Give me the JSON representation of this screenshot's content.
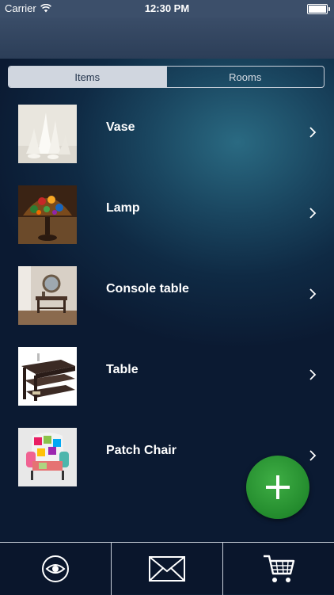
{
  "status": {
    "carrier": "Carrier",
    "time": "12:30 PM",
    "battery_level": 1.0
  },
  "segments": [
    {
      "label": "Items",
      "selected": true
    },
    {
      "label": "Rooms",
      "selected": false
    }
  ],
  "items": [
    {
      "label": "Vase",
      "icon": "vase-thumbnail"
    },
    {
      "label": "Lamp",
      "icon": "lamp-thumbnail"
    },
    {
      "label": "Console table",
      "icon": "console-table-thumbnail"
    },
    {
      "label": "Table",
      "icon": "table-thumbnail"
    },
    {
      "label": "Patch Chair",
      "icon": "patch-chair-thumbnail"
    }
  ],
  "fab": {
    "icon": "plus-icon",
    "color": "#2e9b37"
  },
  "tabbar": [
    {
      "icon": "eye-icon"
    },
    {
      "icon": "mail-icon"
    },
    {
      "icon": "cart-icon"
    }
  ],
  "colors": {
    "background": "#0c1a30",
    "accent": "#2e9b37",
    "segment_active": "#d0d6df"
  }
}
